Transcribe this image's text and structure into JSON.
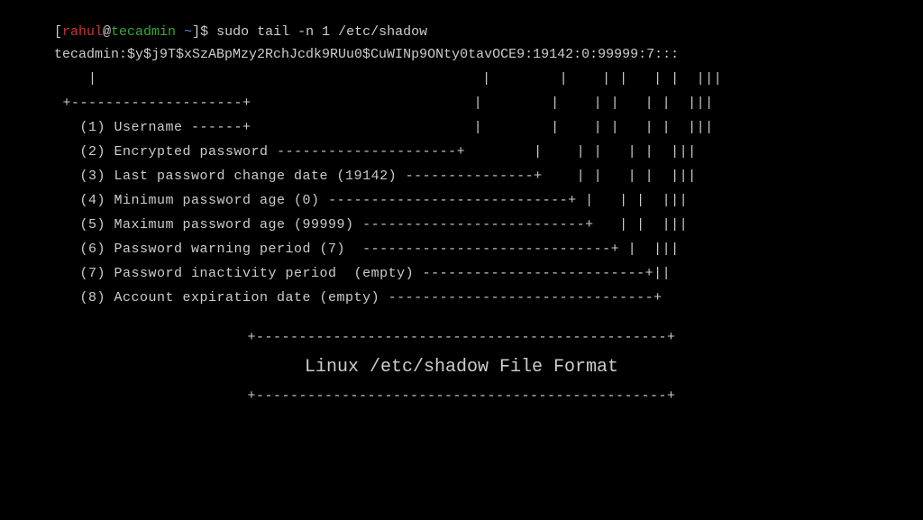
{
  "prompt": {
    "open_bracket": "[",
    "user": "rahul",
    "at": "@",
    "host": "tecadmin",
    "tilde": " ~",
    "close_bracket": "]",
    "dollar": "$",
    "command": "sudo tail -n 1 /etc/shadow"
  },
  "output": "tecadmin:$y$j9T$xSzABpMzy2RchJcdk9RUu0$CuWINp9ONty0tavOCE9:19142:0:99999:7:::",
  "fields": {
    "f1": "(1) Username",
    "f2": "(2) Encrypted password",
    "f3": "(3) Last password change date (19142)",
    "f4": "(4) Minimum password age (0)",
    "f5": "(5) Maximum password age (99999)",
    "f6": "(6) Password warning period (7)",
    "f7": "(7) Password inactivity period  (empty)",
    "f8": "(8) Account expiration date (empty)"
  },
  "footer": {
    "rule": "+------------------------------------------------+",
    "title": "Linux /etc/shadow File Format"
  }
}
